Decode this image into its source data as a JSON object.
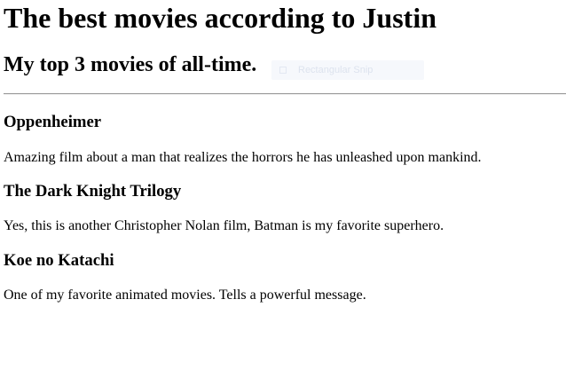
{
  "header": {
    "title": "The best movies according to Justin",
    "subtitle": "My top 3 movies of all-time."
  },
  "overlay": {
    "snip_label": "Rectangular Snip",
    "snip_icon": "rectangle-icon"
  },
  "movies": [
    {
      "title": "Oppenheimer",
      "description": "Amazing film about a man that realizes the horrors he has unleashed upon mankind."
    },
    {
      "title": "The Dark Knight Trilogy",
      "description": "Yes, this is another Christopher Nolan film, Batman is my favorite superhero."
    },
    {
      "title": "Koe no Katachi",
      "description": "One of my favorite animated movies. Tells a powerful message."
    }
  ]
}
